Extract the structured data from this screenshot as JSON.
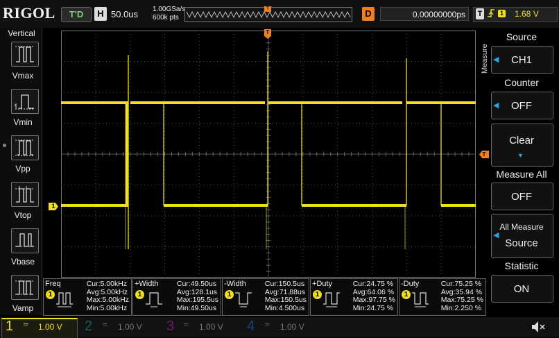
{
  "brand": "RIGOL",
  "top": {
    "trigger_status": "T'D",
    "horizontal_label": "H",
    "timebase": "50.0us",
    "sample_rate": "1.00GSa/s",
    "memory_points": "600k pts",
    "delay_label": "D",
    "delay_value": "0.00000000ps",
    "trigger_label": "T",
    "trigger_source": "1",
    "trigger_level": "1.68 V"
  },
  "left_menu": {
    "title": "Vertical",
    "items": [
      {
        "label": "Vmax",
        "icon": "vmax-icon"
      },
      {
        "label": "Vmin",
        "icon": "vmin-icon"
      },
      {
        "label": "Vpp",
        "icon": "vpp-icon"
      },
      {
        "label": "Vtop",
        "icon": "vtop-icon"
      },
      {
        "label": "Vbase",
        "icon": "vbase-icon"
      },
      {
        "label": "Vamp",
        "icon": "vamp-icon"
      }
    ]
  },
  "right_menu": {
    "side_title": "Measure",
    "source": {
      "title": "Source",
      "value": "CH1"
    },
    "counter": {
      "title": "Counter",
      "value": "OFF"
    },
    "clear": {
      "label": "Clear"
    },
    "measure_all": {
      "title": "Measure All",
      "value": "OFF"
    },
    "all_measure_source": {
      "line1": "All Measure",
      "line2": "Source"
    },
    "statistic": {
      "title": "Statistic",
      "value": "ON"
    }
  },
  "markers": {
    "ch1_offset": "1",
    "trigger_level": "T",
    "trigger_position": "T"
  },
  "measurements": [
    {
      "name": "Freq",
      "cur": "Cur:5.00kHz",
      "avg": "Avg:5.00kHz",
      "max": "Max:5.00kHz",
      "min": "Min:5.00kHz",
      "badge": "1"
    },
    {
      "name": "+Width",
      "cur": "Cur:49.50us",
      "avg": "Avg:128.1us",
      "max": "Max:195.5us",
      "min": "Min:49.50us",
      "badge": "1"
    },
    {
      "name": "-Width",
      "cur": "Cur:150.5us",
      "avg": "Avg:71.88us",
      "max": "Max:150.5us",
      "min": "Min:4.500us",
      "badge": "1"
    },
    {
      "name": "+Duty",
      "cur": "Cur:24.75 %",
      "avg": "Avg:64.06 %",
      "max": "Max:97.75 %",
      "min": "Min:24.75 %",
      "badge": "1"
    },
    {
      "name": "-Duty",
      "cur": "Cur:75.25 %",
      "avg": "Avg:35.94 %",
      "max": "Max:75.25 %",
      "min": "Min:2.250 %",
      "badge": "1"
    }
  ],
  "channels": [
    {
      "num": "1",
      "scale": "1.00 V",
      "color": "#f0e020",
      "active": true
    },
    {
      "num": "2",
      "scale": "1.00 V",
      "color": "#1aa6b0",
      "active": false
    },
    {
      "num": "3",
      "scale": "1.00 V",
      "color": "#c02cc0",
      "active": false
    },
    {
      "num": "4",
      "scale": "1.00 V",
      "color": "#2060d0",
      "active": false
    }
  ],
  "colors": {
    "ch1": "#f0e020",
    "accent": "#f08020",
    "menu_arrow": "#29a3e0"
  }
}
